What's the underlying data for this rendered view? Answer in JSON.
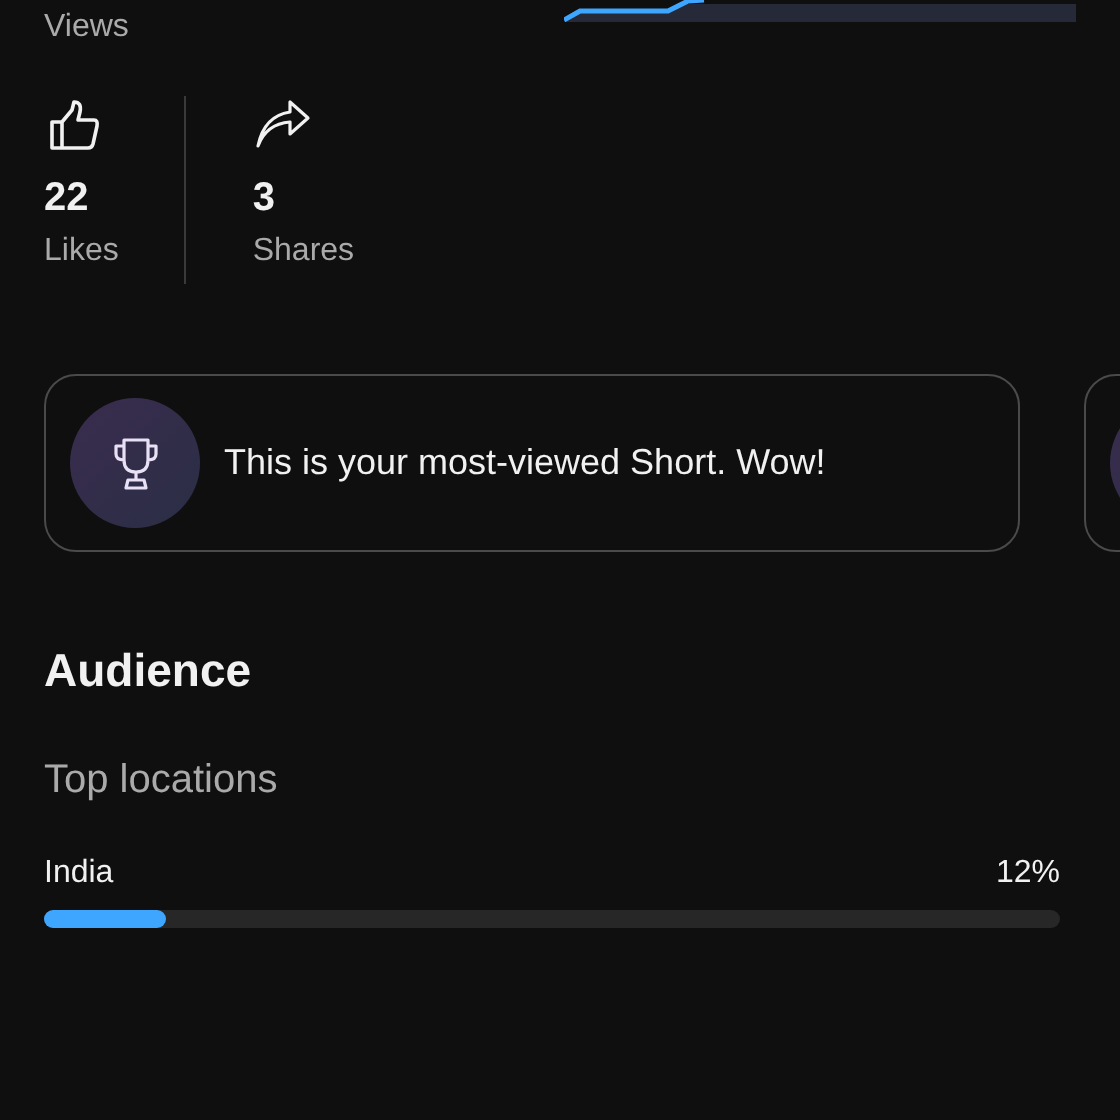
{
  "views": {
    "label": "Views"
  },
  "stats": [
    {
      "kind": "like",
      "value": "22",
      "label": "Likes"
    },
    {
      "kind": "share",
      "value": "3",
      "label": "Shares"
    }
  ],
  "highlights": [
    {
      "kind": "trophy",
      "text": "This is your most-viewed Short. Wow!"
    },
    {
      "kind": "partial"
    }
  ],
  "audience": {
    "title": "Audience",
    "subtitle": "Top locations",
    "locations": [
      {
        "name": "India",
        "percent": "12%",
        "level": 0.12
      }
    ]
  }
}
